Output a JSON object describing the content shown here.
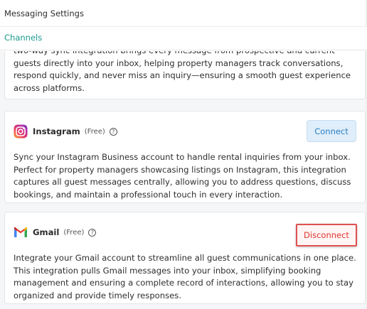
{
  "header": {
    "title": "Messaging Settings"
  },
  "tabs": [
    {
      "label": "Channels",
      "active": true
    }
  ],
  "colors": {
    "accent_teal": "#1a9a8e",
    "connect_blue": "#2d7ec4",
    "disconnect_red": "#e0332f"
  },
  "cards": {
    "partial": {
      "description": "two-way sync integration brings every message from prospective and current guests directly into your inbox, helping property managers track conversations, respond quickly, and never miss an inquiry—ensuring a smooth guest experience across platforms."
    },
    "instagram": {
      "icon": "instagram-icon",
      "name": "Instagram",
      "tag": "(Free)",
      "help_icon": "help-circle-icon",
      "help_glyph": "?",
      "button_label": "Connect",
      "description": "Sync your Instagram Business account to handle rental inquiries from your inbox. Perfect for property managers showcasing listings on Instagram, this integration captures all guest messages centrally, allowing you to address questions, discuss bookings, and maintain a professional touch in every interaction."
    },
    "gmail": {
      "icon": "gmail-icon",
      "name": "Gmail",
      "tag": "(Free)",
      "help_icon": "help-circle-icon",
      "help_glyph": "?",
      "button_label": "Disconnect",
      "description": "Integrate your Gmail account to streamline all guest communications in one place. This integration pulls Gmail messages into your inbox, simplifying booking management and ensuring a complete record of interactions, allowing you to stay organized and provide timely responses."
    }
  }
}
